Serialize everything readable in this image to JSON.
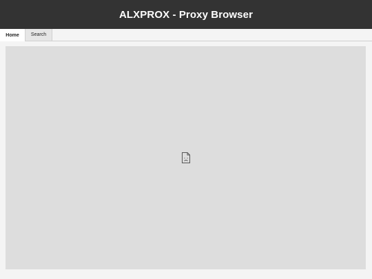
{
  "app": {
    "title": "ALXPROX - Proxy Browser"
  },
  "tabs": [
    {
      "label": "Home",
      "active": true
    },
    {
      "label": "Search",
      "active": false
    }
  ],
  "content": {
    "icon": "broken-page-icon"
  },
  "colors": {
    "titlebar_bg": "#333333",
    "title_text": "#ffffff",
    "page_bg": "#f4f4f4",
    "content_bg": "#dddddd"
  }
}
